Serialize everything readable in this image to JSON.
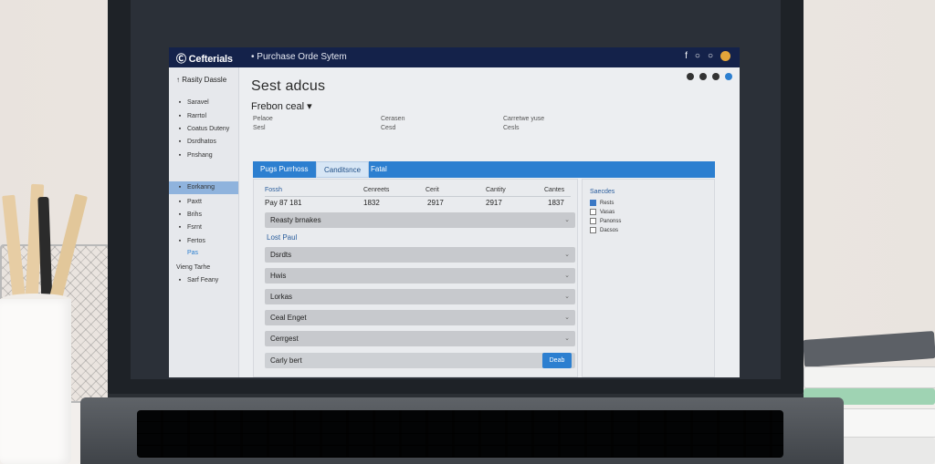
{
  "app": {
    "logo": "Cefterials",
    "name": "Purchase Orde Sytem",
    "header_icons": [
      "f",
      "○",
      "○"
    ]
  },
  "sidebar": {
    "heading": "Rasity Dassle",
    "items": [
      {
        "icon": "▪",
        "label": "Saravel"
      },
      {
        "icon": "▪",
        "label": "Rarrtol"
      },
      {
        "icon": "▪",
        "label": "Coatus Duteny"
      },
      {
        "icon": "▪",
        "label": "Dsrdhatos"
      },
      {
        "icon": "▪",
        "label": "Pnshang"
      },
      {
        "icon": "▪",
        "label": "Eorkanng"
      },
      {
        "icon": "▪",
        "label": "Paxtt"
      },
      {
        "icon": "▪",
        "label": "Brihs"
      },
      {
        "icon": "▪",
        "label": "Fsrnt"
      },
      {
        "icon": "▪",
        "label": "Fertos"
      },
      {
        "icon": "",
        "label": "Pas"
      },
      {
        "icon": "",
        "label": "Vieng Tarhe"
      },
      {
        "icon": "▪",
        "label": "Sarf Feany"
      }
    ],
    "active_index": 5
  },
  "main": {
    "title": "Sest adcus",
    "select_label": "Frebon ceal",
    "fields": [
      {
        "label": "Pelaoe",
        "value": "Sesl"
      },
      {
        "label": "Cerasen",
        "value": "Cesd"
      },
      {
        "label": "Carretwe yuse",
        "value": "Cesls"
      }
    ],
    "tabs": [
      "Pugs Purrhoss",
      "Canditsnce",
      "Fatal"
    ],
    "active_tab": 1
  },
  "table": {
    "headers": [
      "Fossh",
      "Cenreets",
      "Cerit",
      "Cantity",
      "Cantes"
    ],
    "row": [
      "Pay 87 181",
      "1832",
      "2917",
      "2917",
      "1837"
    ]
  },
  "form": {
    "rows": [
      "Reasty brnakes",
      "Dsrdts",
      "Hwis",
      "Lorkas",
      "Ceal Enget",
      "Cerrgest"
    ],
    "section_label": "Lost Paul",
    "last_row": "Carly bert",
    "button_label": "Deab"
  },
  "side_panel": {
    "title": "Saecdes",
    "options": [
      {
        "label": "Rests",
        "checked": true
      },
      {
        "label": "Vasas",
        "checked": false
      },
      {
        "label": "Panonss",
        "checked": false
      },
      {
        "label": "Dacsos",
        "checked": false
      }
    ]
  }
}
